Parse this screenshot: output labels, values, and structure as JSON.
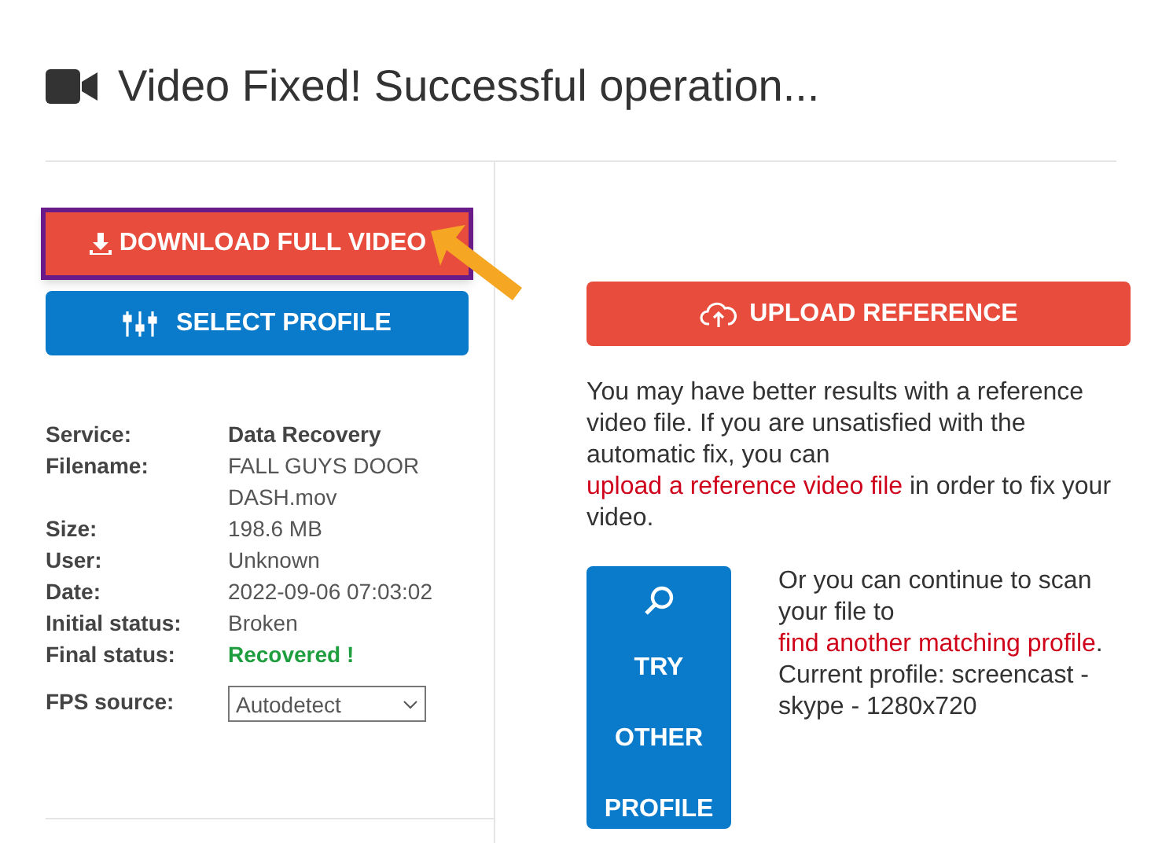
{
  "title": "Video Fixed! Successful operation...",
  "download_button": {
    "label": "DOWNLOAD FULL VIDEO",
    "highlighted": true
  },
  "select_profile_button": {
    "label": "SELECT PROFILE"
  },
  "details": [
    {
      "label": "Service:",
      "value": "Data Recovery",
      "kind": "bold"
    },
    {
      "label": "Filename:",
      "value": "FALL GUYS DOOR DASH.mov",
      "kind": "plain"
    },
    {
      "label": "Size:",
      "value": "198.6 MB",
      "kind": "plain"
    },
    {
      "label": "User:",
      "value": "Unknown",
      "kind": "plain"
    },
    {
      "label": "Date:",
      "value": "2022-09-06 07:03:02",
      "kind": "plain"
    },
    {
      "label": "Initial status:",
      "value": "Broken",
      "kind": "plain"
    },
    {
      "label": "Final status:",
      "value": "Recovered !",
      "kind": "success"
    }
  ],
  "fps_source": {
    "label": "FPS source:",
    "value": "Autodetect"
  },
  "upload_reference_button": {
    "label": "UPLOAD REFERENCE"
  },
  "reference_text": [
    {
      "text": "You may have better results with a reference video file. If you are unsatisfied with the automatic fix, you can ",
      "link": false
    },
    {
      "text": "upload a reference video file",
      "link": true
    },
    {
      "text": " in order to fix your video.",
      "link": false
    }
  ],
  "try_other_profile_button": {
    "lines": [
      "TRY",
      "OTHER",
      "PROFILE"
    ]
  },
  "profile_text": [
    {
      "text": "Or you can continue to scan your file to ",
      "link": false
    },
    {
      "text": "find another matching profile",
      "link": true
    },
    {
      "text": ". Current profile: screencast - skype - 1280x720",
      "link": false
    }
  ]
}
